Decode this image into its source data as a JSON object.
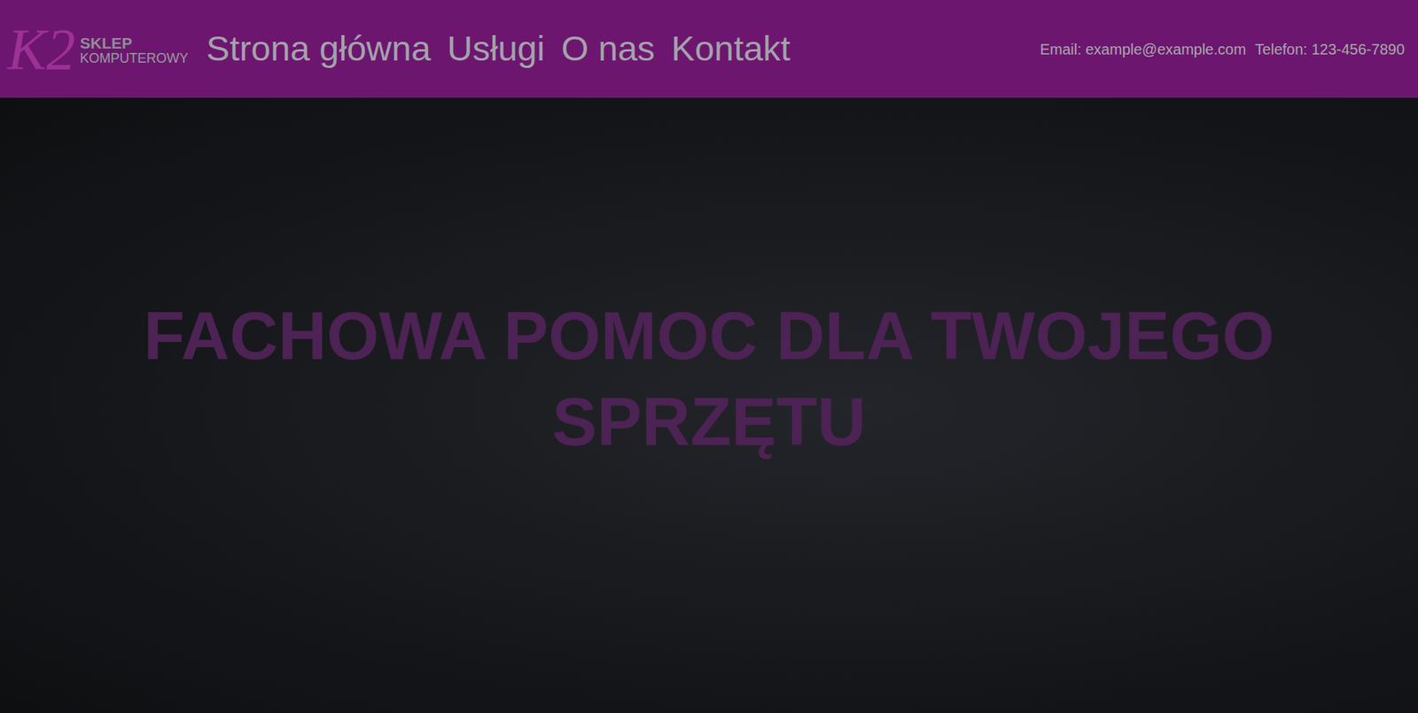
{
  "logo": {
    "mark": "K2",
    "line1": "SKLEP",
    "line2": "KOMPUTEROWY"
  },
  "nav": [
    {
      "label": "Strona główna"
    },
    {
      "label": "Usługi"
    },
    {
      "label": "O nas"
    },
    {
      "label": "Kontakt"
    }
  ],
  "contact": {
    "email": "Email: example@example.com",
    "phone": "Telefon: 123-456-7890"
  },
  "hero": {
    "title": "FACHOWA POMOC DLA TWOJEGO SPRZĘTU"
  }
}
